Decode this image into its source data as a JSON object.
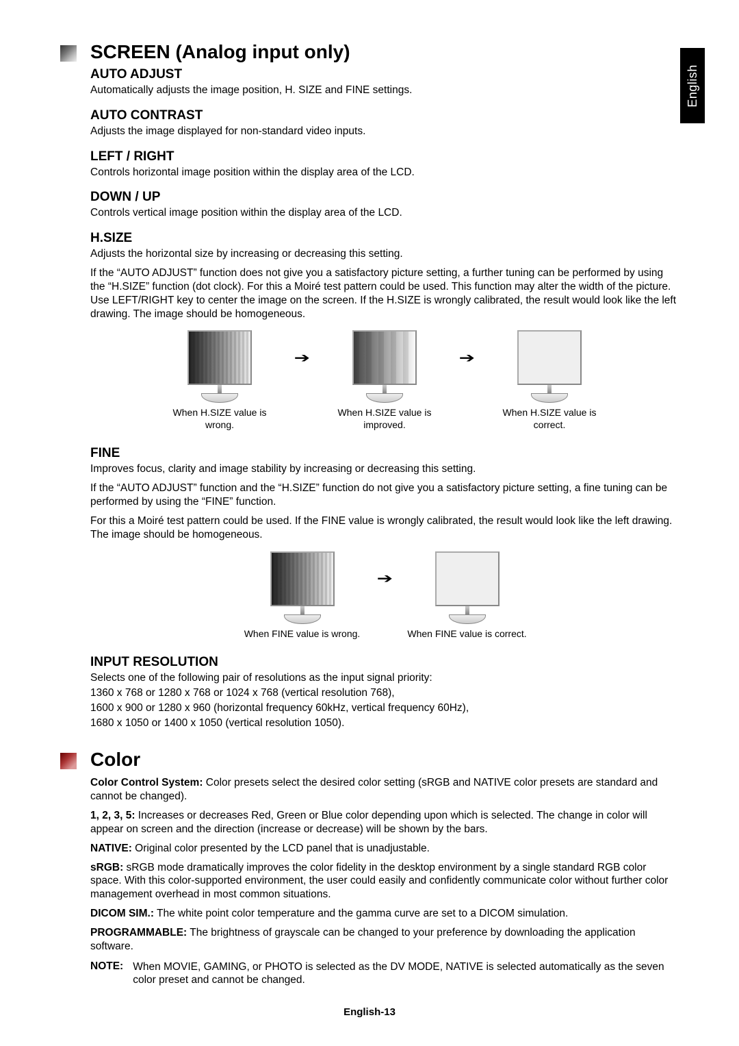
{
  "langTab": "English",
  "screen": {
    "title": "SCREEN (Analog input only)",
    "autoAdjust": {
      "heading": "AUTO ADJUST",
      "text": "Automatically adjusts the image position, H. SIZE and FINE settings."
    },
    "autoContrast": {
      "heading": "AUTO CONTRAST",
      "text": "Adjusts the image displayed for non-standard video inputs."
    },
    "leftRight": {
      "heading": "LEFT / RIGHT",
      "text": "Controls horizontal image position within the display area of the LCD."
    },
    "downUp": {
      "heading": "DOWN / UP",
      "text": "Controls vertical image position within the display area of the LCD."
    },
    "hsize": {
      "heading": "H.SIZE",
      "text1": "Adjusts the horizontal size by increasing or decreasing this setting.",
      "text2": "If the “AUTO ADJUST” function does not give you a satisfactory picture setting, a further tuning can be performed by using the “H.SIZE” function (dot clock). For this a Moiré test pattern could be used. This function may alter the width of the picture. Use LEFT/RIGHT key to center the image on the screen. If the H.SIZE is wrongly calibrated, the result would look like the left drawing. The image should be homogeneous.",
      "cap1": "When H.SIZE value is wrong.",
      "cap2": "When H.SIZE value is improved.",
      "cap3": "When H.SIZE value is correct."
    },
    "fine": {
      "heading": "FINE",
      "text1": "Improves focus, clarity and image stability by increasing or decreasing this setting.",
      "text2": "If the “AUTO ADJUST” function and the “H.SIZE” function do not give you a satisfactory picture setting, a fine tuning can be performed by using the “FINE” function.",
      "text3": "For this a Moiré test pattern could be used. If the FINE value is wrongly calibrated, the result would look like the left drawing. The image should be homogeneous.",
      "cap1": "When FINE value is wrong.",
      "cap2": "When FINE value is correct."
    },
    "inputRes": {
      "heading": "INPUT RESOLUTION",
      "l1": "Selects one of the following pair of resolutions as the input signal priority:",
      "l2": "1360 x 768 or 1280 x 768 or 1024 x 768 (vertical resolution 768),",
      "l3": "1600 x 900 or 1280 x 960 (horizontal frequency 60kHz, vertical frequency 60Hz),",
      "l4": "1680 x 1050 or 1400 x 1050 (vertical resolution 1050)."
    }
  },
  "color": {
    "title": "Color",
    "ccs_label": "Color Control System:",
    "ccs_text": " Color presets select the desired color setting (sRGB and NATIVE color presets are standard and cannot be changed).",
    "p1235_label": "1, 2, 3, 5:",
    "p1235_text": " Increases or decreases Red, Green or Blue color depending upon which is selected. The change in color will appear on screen and the direction (increase or decrease) will be shown by the bars.",
    "native_label": "NATIVE:",
    "native_text": " Original color presented by the LCD panel that is unadjustable.",
    "srgb_label": "sRGB:",
    "srgb_text": " sRGB mode dramatically improves the color fidelity in the desktop environment by a single standard RGB color space. With this color-supported environment, the user could easily and confidently communicate color without further color management overhead in most common situations.",
    "dicom_label": "DICOM SIM.:",
    "dicom_text": " The white point color temperature and the gamma curve are set to a DICOM simulation.",
    "prog_label": "PROGRAMMABLE:",
    "prog_text": " The brightness of grayscale can be changed to your preference by downloading the application software.",
    "note_label": "NOTE:",
    "note_text": "When MOVIE, GAMING, or PHOTO is selected as the DV MODE, NATIVE is selected automatically as the seven color preset and cannot be changed."
  },
  "footer": "English-13"
}
